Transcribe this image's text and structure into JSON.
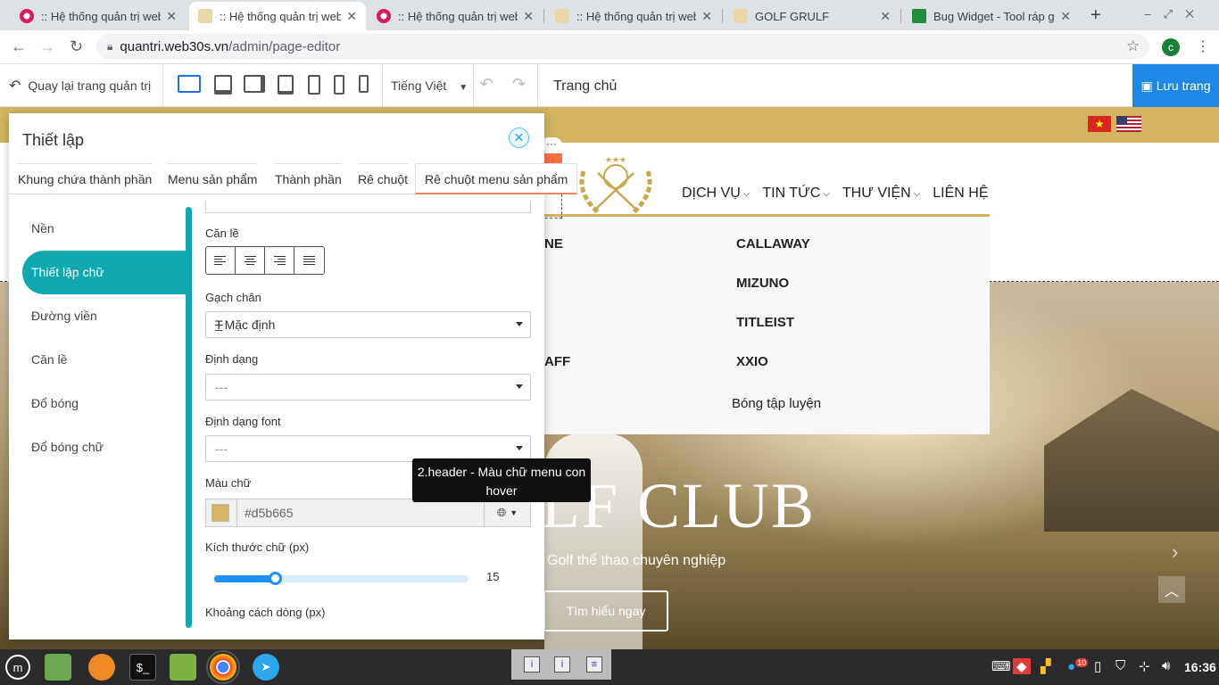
{
  "browser": {
    "tabs": [
      {
        "label": ":: Hệ thống quản trị web",
        "active": false,
        "icon": "web30s-favicon-icon"
      },
      {
        "label": ":: Hệ thống quản trị web",
        "active": true,
        "icon": "golf-favicon-icon"
      },
      {
        "label": ":: Hệ thống quản trị web",
        "active": false,
        "icon": "web30s-favicon-icon"
      },
      {
        "label": ":: Hệ thống quản trị web",
        "active": false,
        "icon": "golf-favicon-icon"
      },
      {
        "label": "GOLF GRULF",
        "active": false,
        "icon": "golf-favicon-icon"
      },
      {
        "label": "Bug Widget - Tool ráp g",
        "active": false,
        "icon": "sheets-icon"
      }
    ],
    "new_tab": "+",
    "url_host": "quantri.web30s.vn",
    "url_path": "/admin/page-editor",
    "profile_initial": "c"
  },
  "editor": {
    "back_label": "Quay lại trang quản trị",
    "language": "Tiếng Việt",
    "page_name": "Trang chủ",
    "save_label": "Lưu trang"
  },
  "site": {
    "nav": [
      {
        "label": "DỊCH VỤ",
        "chevron": true
      },
      {
        "label": "TIN TỨC",
        "chevron": true
      },
      {
        "label": "THƯ VIỆN",
        "chevron": true
      },
      {
        "label": "LIÊN HỆ",
        "chevron": false
      }
    ],
    "mega_left": [
      "NE",
      "AFF"
    ],
    "mega_right": [
      "CALLAWAY",
      "MIZUNO",
      "TITLEIST",
      "XXIO"
    ],
    "mega_sub": "Bóng tập luyện",
    "hero_title": "LF CLUB",
    "hero_subtitle": "Golf thể thao chuyên nghiệp",
    "hero_button": "Tìm hiểu ngay"
  },
  "panel": {
    "title": "Thiết lập",
    "tabs": [
      {
        "label": "Khung chứa thành phần",
        "active": false
      },
      {
        "label": "Menu sản phẩm",
        "active": false
      },
      {
        "label": "Thành phần",
        "active": false
      },
      {
        "label": "Rê chuột",
        "active": false
      },
      {
        "label": "Rê chuột menu sản phẩm",
        "active": true
      }
    ],
    "side_items": [
      {
        "label": "Nền",
        "active": false
      },
      {
        "label": "Thiết lập chữ",
        "active": true
      },
      {
        "label": "Đường viền",
        "active": false
      },
      {
        "label": "Căn lề",
        "active": false
      },
      {
        "label": "Đổ bóng",
        "active": false
      },
      {
        "label": "Đổ bóng chữ",
        "active": false
      }
    ],
    "align_label": "Căn lề",
    "underline_label": "Gạch chân",
    "underline_value": "Mặc định",
    "format_label": "Định dạng",
    "format_value": "---",
    "font_format_label": "Định dạng font",
    "font_format_value": "---",
    "color_label": "Màu chữ",
    "color_value": "#d5b665",
    "font_size_label": "Kích thước chữ (px)",
    "font_size_value": 15,
    "font_size_fraction": 0.24,
    "line_height_label": "Khoảng cách dòng (px)"
  },
  "tooltip": "2.header - Màu chữ menu con hover",
  "taskbar": {
    "clock": "16:36",
    "notification_count": "10"
  },
  "colors": {
    "accent": "#0fa8b0",
    "gold": "#d3b45e",
    "save_blue": "#1e88e5",
    "slider_blue": "#1e90ff"
  }
}
